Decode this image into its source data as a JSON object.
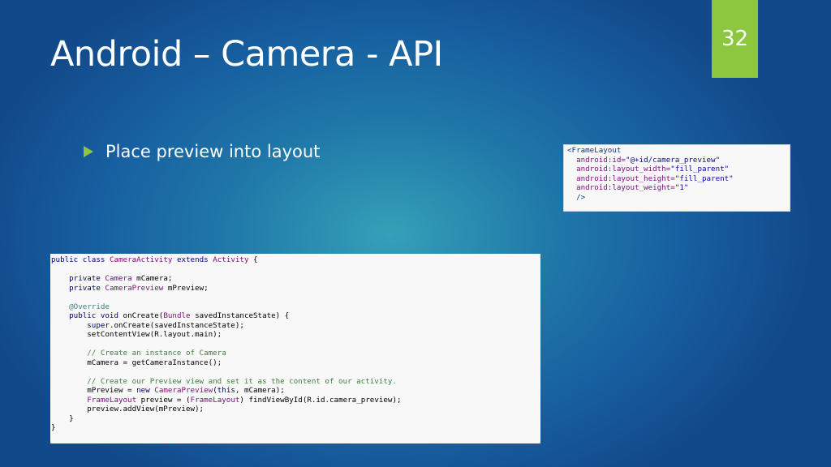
{
  "slide": {
    "title": "Android – Camera - API",
    "page_number": "32",
    "bullet": "Place preview into layout"
  },
  "xml_code": {
    "l1": "<FrameLayout",
    "l2_attr": "android:id=",
    "l2_val": "\"@+id/camera_preview\"",
    "l3_attr": "android:layout_width=",
    "l3_val": "\"fill_parent\"",
    "l4_attr": "android:layout_height=",
    "l4_val": "\"fill_parent\"",
    "l5_attr": "android:layout_weight=",
    "l5_val": "\"1\"",
    "l6": "/>"
  },
  "java_code": {
    "l1_kw": "public class",
    "l1_ty": "CameraActivity",
    "l1_kw2": "extends",
    "l1_ty2": "Activity",
    "l1_rest": "{",
    "l3_kw": "private",
    "l3_ty": "Camera",
    "l3_rest": "mCamera;",
    "l4_kw": "private",
    "l4_ty": "CameraPreview",
    "l4_rest": "mPreview;",
    "l6_an": "@Override",
    "l7_kw": "public void",
    "l7_mid": "onCreate(",
    "l7_ty": "Bundle",
    "l7_rest": "savedInstanceState) {",
    "l8_kw": "super",
    "l8_rest": ".onCreate(savedInstanceState);",
    "l9": "setContentView(R.layout.main);",
    "l11_cm": "// Create an instance of Camera",
    "l12": "mCamera = getCameraInstance();",
    "l14_cm": "// Create our Preview view and set it as the content of our activity.",
    "l15_a": "mPreview =",
    "l15_kw": "new",
    "l15_ty": "CameraPreview",
    "l15_b": "(",
    "l15_kw2": "this",
    "l15_c": ", mCamera);",
    "l16_ty": "FrameLayout",
    "l16_a": "preview = (",
    "l16_ty2": "FrameLayout",
    "l16_b": ") findViewById(R.id.camera_preview);",
    "l17": "preview.addView(mPreview);",
    "l18": "}",
    "l19": "}"
  },
  "colors": {
    "accent_green": "#8dc63f",
    "background_blue": "#1f77a8"
  }
}
